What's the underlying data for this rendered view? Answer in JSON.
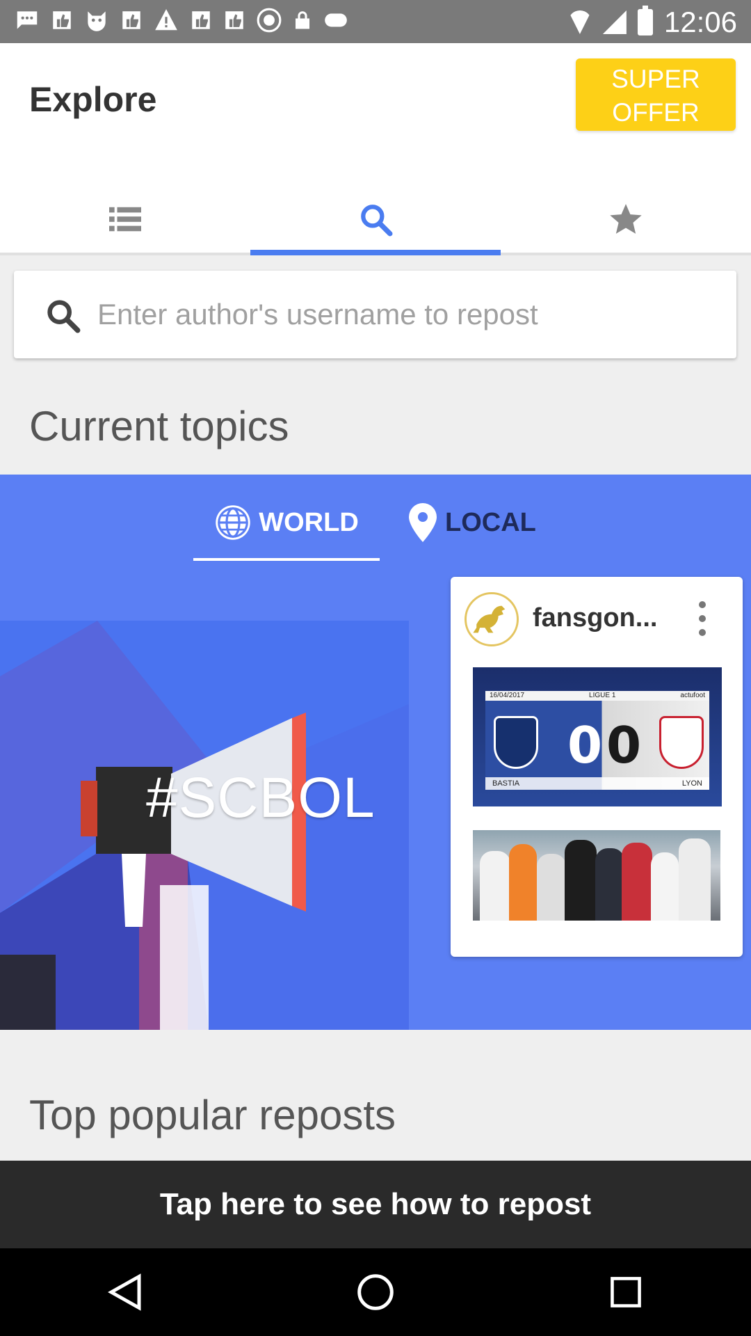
{
  "status_bar": {
    "time": "12:06",
    "notification_icons": [
      "chat-icon",
      "thumbs-up-icon",
      "cat-icon",
      "thumbs-up-icon",
      "warning-icon",
      "thumbs-up-icon",
      "thumbs-up-icon",
      "fake-gps-icon",
      "lock-icon",
      "game-icon"
    ]
  },
  "header": {
    "title": "Explore",
    "super_offer_label": "SUPER\nOFFER",
    "tabs": [
      {
        "icon": "list-icon",
        "active": false
      },
      {
        "icon": "search-icon",
        "active": true
      },
      {
        "icon": "star-icon",
        "active": false
      }
    ]
  },
  "search": {
    "placeholder": "Enter author's username to repost",
    "icon": "search-icon"
  },
  "current_topics": {
    "title": "Current topics",
    "tabs": [
      {
        "label": "WORLD",
        "icon": "globe-icon",
        "active": true
      },
      {
        "label": "LOCAL",
        "icon": "location-pin-icon",
        "active": false
      }
    ],
    "hero": {
      "hashtag": "#SCBOL",
      "icon": "megaphone-icon"
    },
    "post": {
      "author": "fansgon...",
      "score_left": "0",
      "score_right": "0",
      "league": "LIGUE 1",
      "date": "16/04/2017",
      "source": "actufoot",
      "team_left": "BASTIA",
      "team_right": "LYON"
    }
  },
  "top_popular": {
    "title": "Top popular reposts"
  },
  "banner": {
    "label": "Tap here to see how to repost"
  },
  "colors": {
    "accent": "#4a7cf0",
    "topics_bg": "#5b7ff4",
    "super_offer": "#fdd017",
    "banner_bg": "#2a2a2a"
  }
}
